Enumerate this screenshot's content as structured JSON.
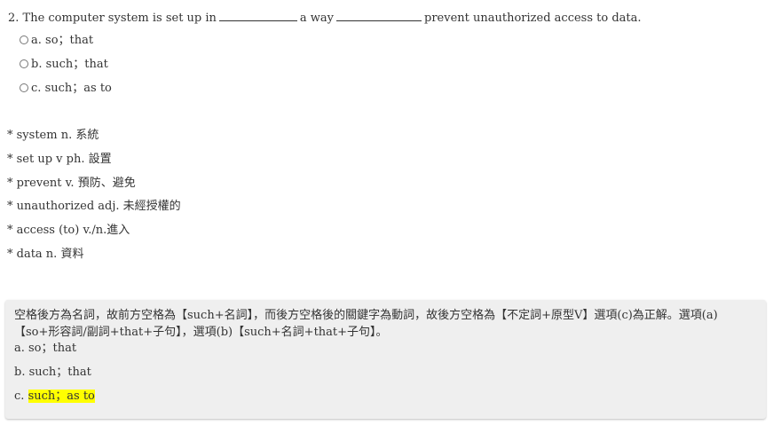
{
  "question": {
    "part1": "2. The computer system is set up in",
    "part2": "a way",
    "part3": "prevent unauthorized access to data."
  },
  "options": [
    {
      "letter": "a.",
      "text": "so；that"
    },
    {
      "letter": "b.",
      "text": "such；that"
    },
    {
      "letter": "c.",
      "text": "such；as to"
    }
  ],
  "vocabulary": [
    "* system n. 系統",
    "* set up v ph. 設置",
    "* prevent v. 預防、避免",
    "* unauthorized adj. 未經授權的",
    "* access (to) v./n.進入",
    "* data n. 資料"
  ],
  "explanation": {
    "text": "空格後方為名詞，故前方空格為【such+名詞】，而後方空格後的關鍵字為動詞，故後方空格為【不定詞+原型V】選項(c)為正解。選項(a)【so+形容詞/副詞+that+子句】，選項(b)【such+名詞+that+子句】。",
    "line_a": "a. so；that",
    "line_b": "b. such；that",
    "line_c_prefix": "c.",
    "line_c_answer": "such；as to"
  },
  "colors": {
    "highlight": "#ffff00",
    "explanation_bg": "#efefef"
  }
}
